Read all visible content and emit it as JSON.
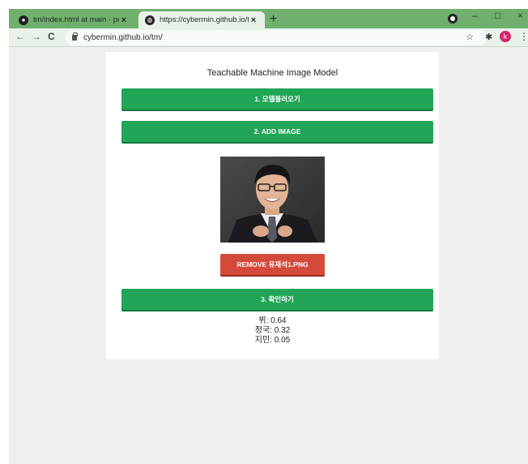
{
  "browser": {
    "tabs": [
      {
        "title": "tm/index.html at main · pnumi",
        "close": "×"
      },
      {
        "title": "https://cybermin.github.io/tm/",
        "close": "×"
      }
    ],
    "new_tab": "+",
    "address": "cybermin.github.io/tm/",
    "profile_initial": "k",
    "window_controls": {
      "minimize": "–",
      "maximize": "□",
      "close": "×"
    },
    "nav": {
      "back": "←",
      "forward": "→",
      "reload": "C"
    }
  },
  "page": {
    "title": "Teachable Machine Image Model",
    "load_model_label": "1. 모델불러오기",
    "add_image_label": "2. ADD IMAGE",
    "remove_label": "REMOVE 유재석1.PNG",
    "predict_label": "3. 확인하기",
    "results": [
      {
        "text": "뷔: 0.64"
      },
      {
        "text": "정국: 0.32"
      },
      {
        "text": "지민: 0.05"
      }
    ]
  },
  "colors": {
    "tab_strip": "#6fb06f",
    "primary_button": "#21a557",
    "remove_button": "#d44a3a",
    "page_background": "#efefef"
  },
  "icons": {
    "tab1": "github-icon",
    "tab2": "globe-icon",
    "lock": "lock-icon",
    "bookmark": "star-icon",
    "extensions": "puzzle-icon",
    "menu": "kebab-menu-icon"
  }
}
